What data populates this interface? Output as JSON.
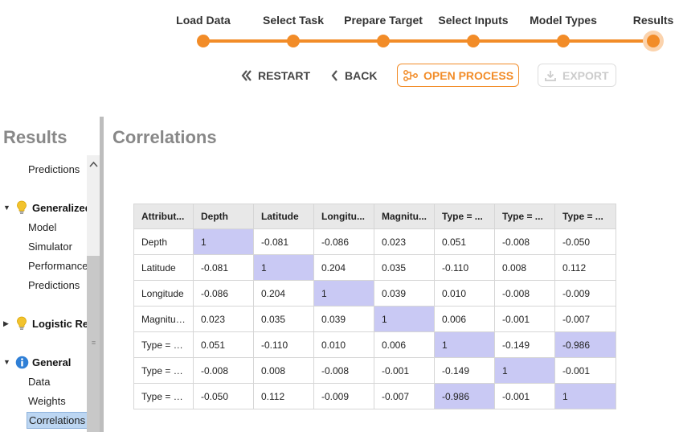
{
  "wizard": {
    "steps": [
      {
        "label": "Load Data"
      },
      {
        "label": "Select Task"
      },
      {
        "label": "Prepare Target"
      },
      {
        "label": "Select Inputs"
      },
      {
        "label": "Model Types"
      },
      {
        "label": "Results"
      }
    ],
    "current_step": 6
  },
  "toolbar": {
    "restart": "RESTART",
    "back": "BACK",
    "open_process": "OPEN PROCESS",
    "export": "EXPORT"
  },
  "nav": {
    "title": "Results",
    "top_item": "Predictions",
    "groups": [
      {
        "label": "Generalized",
        "icon": "lightbulb-icon",
        "expanded": true,
        "items": [
          "Model",
          "Simulator",
          "Performance",
          "Predictions"
        ]
      },
      {
        "label": "Logistic Reg",
        "icon": "lightbulb-icon",
        "expanded": false,
        "items": []
      },
      {
        "label": "General",
        "icon": "info-icon",
        "expanded": true,
        "items": [
          "Data",
          "Weights",
          "Correlations"
        ]
      }
    ],
    "selected": "Correlations"
  },
  "main": {
    "title": "Correlations"
  },
  "table": {
    "columns": [
      "Attribut...",
      "Depth",
      "Latitude",
      "Longitu...",
      "Magnitu...",
      "Type = ...",
      "Type = ...",
      "Type = ..."
    ],
    "rows": [
      {
        "attr": "Depth",
        "values": [
          "1",
          "-0.081",
          "-0.086",
          "0.023",
          "0.051",
          "-0.008",
          "-0.050"
        ]
      },
      {
        "attr": "Latitude",
        "values": [
          "-0.081",
          "1",
          "0.204",
          "0.035",
          "-0.110",
          "0.008",
          "0.112"
        ]
      },
      {
        "attr": "Longitude",
        "values": [
          "-0.086",
          "0.204",
          "1",
          "0.039",
          "0.010",
          "-0.008",
          "-0.009"
        ]
      },
      {
        "attr": "Magnitude",
        "values": [
          "0.023",
          "0.035",
          "0.039",
          "1",
          "0.006",
          "-0.001",
          "-0.007"
        ]
      },
      {
        "attr": "Type = E...",
        "values": [
          "0.051",
          "-0.110",
          "0.010",
          "0.006",
          "1",
          "-0.149",
          "-0.986"
        ]
      },
      {
        "attr": "Type = E...",
        "values": [
          "-0.008",
          "0.008",
          "-0.008",
          "-0.001",
          "-0.149",
          "1",
          "-0.001"
        ]
      },
      {
        "attr": "Type = N...",
        "values": [
          "-0.050",
          "0.112",
          "-0.009",
          "-0.007",
          "-0.986",
          "-0.001",
          "1"
        ]
      }
    ],
    "highlight_color": "#c9c9f4"
  },
  "colors": {
    "accent": "#f28c28",
    "accent_light": "#fbd3ad",
    "muted_title": "#888888"
  }
}
